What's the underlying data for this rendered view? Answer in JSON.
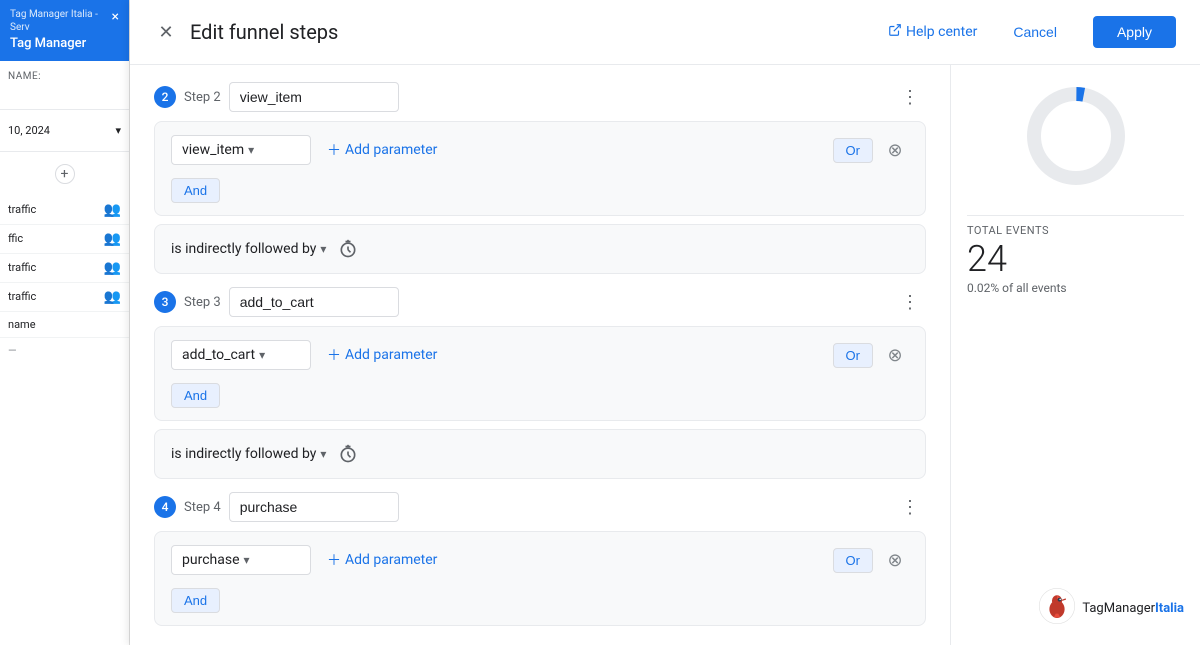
{
  "sidebar": {
    "app_subtitle": "Tag Manager Italia - Serv",
    "app_name": "Tag Manager",
    "close_icon": "×",
    "name_label": "NAME:",
    "date_value": "10, 2024",
    "add_icon": "+",
    "items": [
      {
        "label": "traffic",
        "icon": "👥"
      },
      {
        "label": "ffic",
        "icon": "👥"
      },
      {
        "label": "traffic",
        "icon": "👥"
      },
      {
        "label": "traffic",
        "icon": "👥"
      }
    ],
    "segment_label": "name",
    "segment_value": "—"
  },
  "modal": {
    "close_icon": "✕",
    "title": "Edit funnel steps",
    "help_center_label": "Help center",
    "cancel_label": "Cancel",
    "apply_label": "Apply"
  },
  "steps": [
    {
      "number": "2",
      "label": "Step 2",
      "name_value": "view_item",
      "name_placeholder": "view_item",
      "events": [
        {
          "event_name": "view_item"
        }
      ],
      "and_label": "And",
      "connector": "is indirectly followed by"
    },
    {
      "number": "3",
      "label": "Step 3",
      "name_value": "add_to_cart",
      "name_placeholder": "add_to_cart",
      "events": [
        {
          "event_name": "add_to_cart"
        }
      ],
      "and_label": "And",
      "connector": "is indirectly followed by"
    },
    {
      "number": "4",
      "label": "Step 4",
      "name_value": "purchase",
      "name_placeholder": "purchase",
      "events": [
        {
          "event_name": "purchase"
        }
      ],
      "and_label": "And"
    }
  ],
  "buttons": {
    "add_parameter": "+ Add parameter",
    "or": "Or",
    "more_vert": "⋮",
    "arrow_down": "▾"
  },
  "stats": {
    "total_events_label": "TOTAL EVENTS",
    "total_events_value": "24",
    "total_events_sub": "0.02% of all events"
  },
  "watermark": {
    "text_normal": "TagManager",
    "text_bold": "Italia"
  }
}
